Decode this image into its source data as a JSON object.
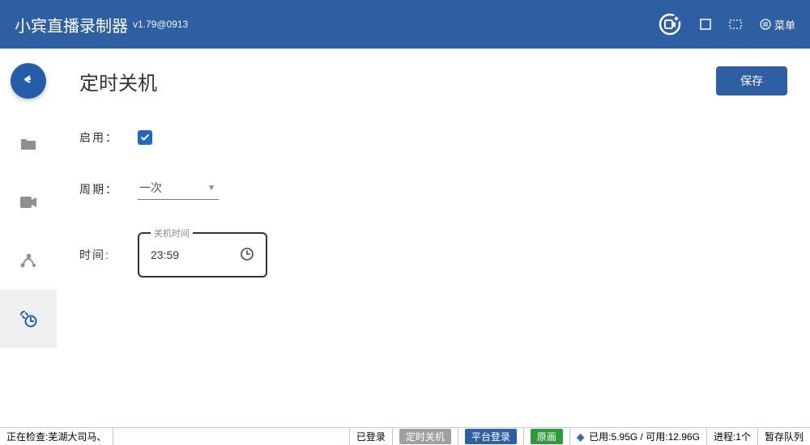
{
  "header": {
    "title": "小宾直播录制器",
    "version": "v1.79@0913",
    "menu_label": "菜单"
  },
  "page": {
    "title": "定时关机",
    "save_label": "保存"
  },
  "form": {
    "enable_label": "启用：",
    "enable_checked": true,
    "period_label": "周期：",
    "period_value": "一次",
    "time_label": "时间:",
    "time_legend": "关机时间",
    "time_value": "23:59"
  },
  "status": {
    "checking_prefix": "正在检查:",
    "checking_target": "芜湖大司马、",
    "login": "已登录",
    "chip_shutdown": "定时关机",
    "chip_platform": "平台登录",
    "chip_quality": "原画",
    "disk_used_label": "已用:",
    "disk_used": "5.95G",
    "disk_avail_label": "可用:",
    "disk_avail": "12.96G",
    "proc_label": "进程:",
    "proc_count": "1个",
    "queue": "暂存队列"
  }
}
